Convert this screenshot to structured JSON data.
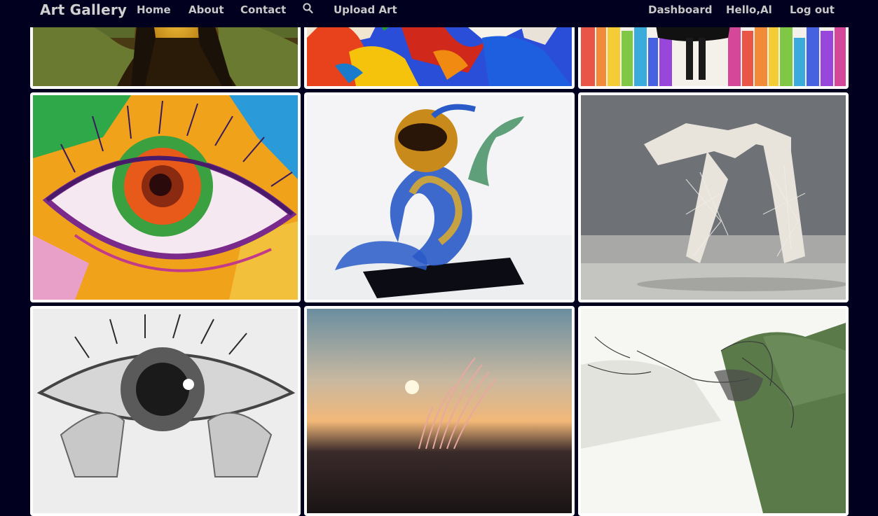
{
  "navbar": {
    "brand": "Art Gallery",
    "links": [
      "Home",
      "About",
      "Contact"
    ],
    "search_icon": "search-icon",
    "upload": "Upload Art",
    "dashboard": "Dashboard",
    "greeting": "Hello,Al",
    "logout": "Log out"
  },
  "gallery": {
    "artworks": [
      {
        "subject": "mona-lisa-painting"
      },
      {
        "subject": "abstract-paint-strokes"
      },
      {
        "subject": "rainbow-drip-figure"
      },
      {
        "subject": "colorful-eye-painting"
      },
      {
        "subject": "glass-sculpture"
      },
      {
        "subject": "wire-hands-sculpture"
      },
      {
        "subject": "pencil-eye-drawing"
      },
      {
        "subject": "sunset-feather-photo"
      },
      {
        "subject": "wire-fairy-sculpture"
      }
    ]
  }
}
